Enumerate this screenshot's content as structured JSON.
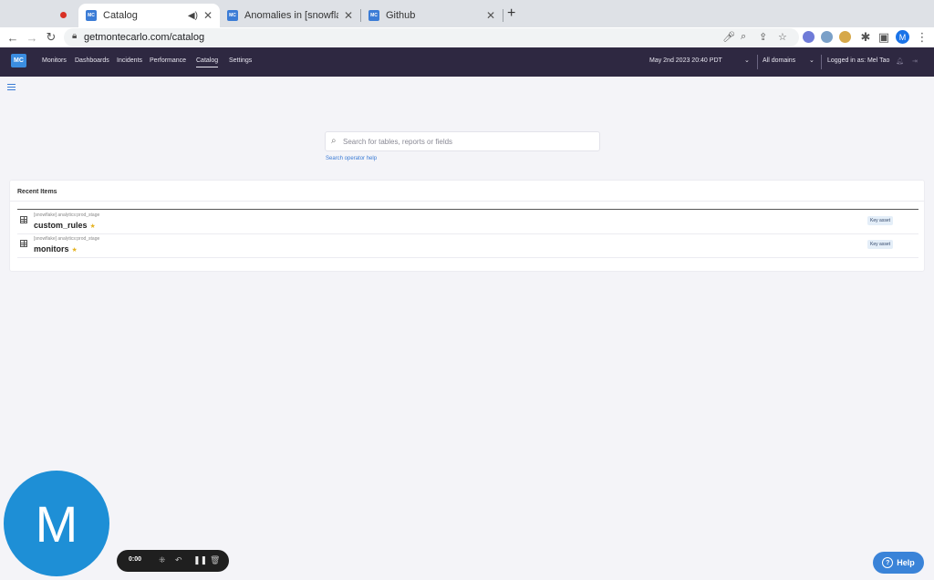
{
  "browser": {
    "tabs": [
      {
        "title": "Catalog",
        "favicon": "MC",
        "active": true
      },
      {
        "title": "Anomalies in [snowflake] ana",
        "favicon": "MC",
        "active": false
      },
      {
        "title": "Github",
        "favicon": "MC",
        "active": false
      }
    ],
    "url": "getmontecarlo.com/catalog",
    "profile_initial": "M"
  },
  "app": {
    "logo": "MC",
    "nav": [
      "Monitors",
      "Dashboards",
      "Incidents",
      "Performance",
      "Catalog",
      "Settings"
    ],
    "active_nav": "Catalog",
    "datetime": "May 2nd 2023 20:40 PDT",
    "domains": "All domains",
    "logged_in": "Logged in as: Mel Tao"
  },
  "search": {
    "placeholder": "Search for tables, reports or fields",
    "help_link": "Search operator help"
  },
  "recent": {
    "title": "Recent Items",
    "items": [
      {
        "path": "[snowflake] analytics:prod_stage",
        "name": "custom_rules",
        "badge": "Key asset"
      },
      {
        "path": "[snowflake] analytics:prod_stage",
        "name": "monitors",
        "badge": "Key asset"
      }
    ]
  },
  "overlays": {
    "webcam_initial": "M",
    "recording_time": "0:00",
    "help_label": "Help"
  },
  "colors": {
    "nav_bg": "#2e2841",
    "accent": "#3a83d8",
    "page_bg": "#f4f4f8"
  }
}
